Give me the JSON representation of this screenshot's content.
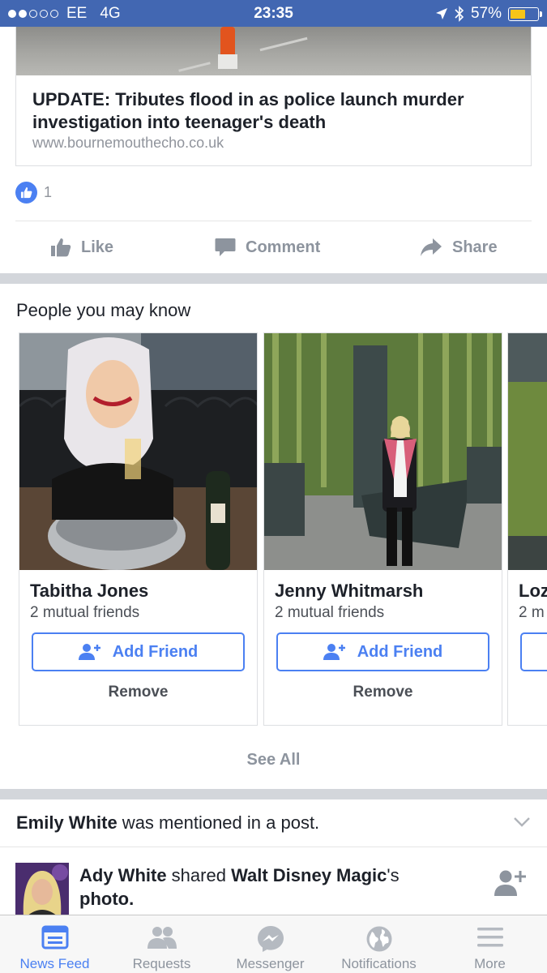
{
  "status_bar": {
    "carrier": "EE",
    "network": "4G",
    "time": "23:35",
    "battery": "57%",
    "battery_level": 0.57,
    "signal_bars_filled": 2,
    "signal_bars_total": 5
  },
  "link_preview": {
    "title": "UPDATE: Tributes flood in as police launch murder investigation into teenager's death",
    "domain": "www.bournemouthecho.co.uk"
  },
  "reactions": {
    "count": "1",
    "badge_color": "#4b80f2"
  },
  "post_actions": {
    "like": "Like",
    "comment": "Comment",
    "share": "Share"
  },
  "pymk": {
    "title": "People you may know",
    "cards": [
      {
        "name": "Tabitha Jones",
        "mutual": "2 mutual friends",
        "add_label": "Add Friend",
        "remove_label": "Remove"
      },
      {
        "name": "Jenny Whitmarsh",
        "mutual": "2 mutual friends",
        "add_label": "Add Friend",
        "remove_label": "Remove"
      },
      {
        "name": "Loz",
        "mutual": "2 m",
        "add_label": "",
        "remove_label": ""
      }
    ],
    "see_all": "See All"
  },
  "mention": {
    "name": "Emily White",
    "rest": " was mentioned in a post."
  },
  "story": {
    "actor": "Ady White",
    "verb": " shared ",
    "target": "Walt Disney Magic",
    "suffix": "'s",
    "object": "photo."
  },
  "tabs": [
    {
      "label": "News Feed",
      "icon": "news-feed-icon",
      "active": true
    },
    {
      "label": "Requests",
      "icon": "friend-requests-icon",
      "active": false
    },
    {
      "label": "Messenger",
      "icon": "messenger-icon",
      "active": false
    },
    {
      "label": "Notifications",
      "icon": "globe-icon",
      "active": false
    },
    {
      "label": "More",
      "icon": "menu-icon",
      "active": false
    }
  ],
  "colors": {
    "brand": "#4267b2",
    "accent": "#4b80f2",
    "muted": "#8d949e"
  }
}
